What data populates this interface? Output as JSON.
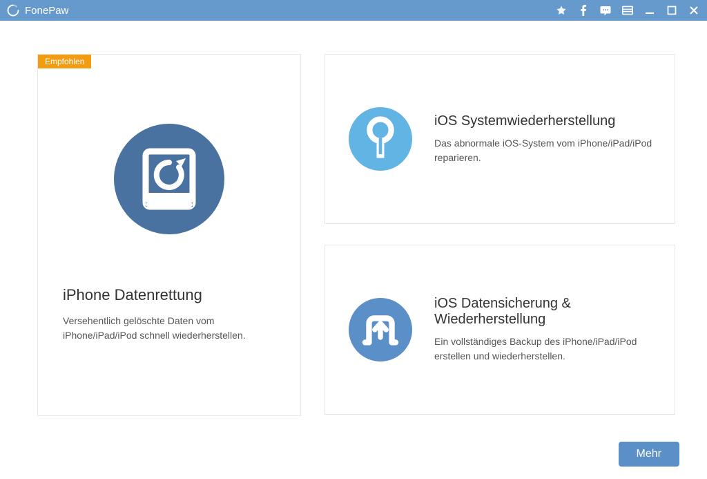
{
  "app": {
    "title": "FonePaw"
  },
  "badge": {
    "text": "Empfohlen"
  },
  "cards": {
    "recovery": {
      "title": "iPhone Datenrettung",
      "desc": "Versehentlich gelöschte Daten vom iPhone/iPad/iPod schnell wiederherstellen."
    },
    "system": {
      "title": "iOS Systemwiederherstellung",
      "desc": "Das abnormale iOS-System vom iPhone/iPad/iPod reparieren."
    },
    "backup": {
      "title": "iOS Datensicherung & Wiederherstellung",
      "desc": "Ein vollständiges Backup des iPhone/iPad/iPod erstellen und wiederherstellen."
    }
  },
  "buttons": {
    "more": "Mehr"
  },
  "colors": {
    "titlebar": "#6699cc",
    "badge": "#f39c12",
    "icon_dark": "#4a72a0",
    "icon_light": "#61b4e4",
    "icon_medium": "#5a8fc7"
  }
}
